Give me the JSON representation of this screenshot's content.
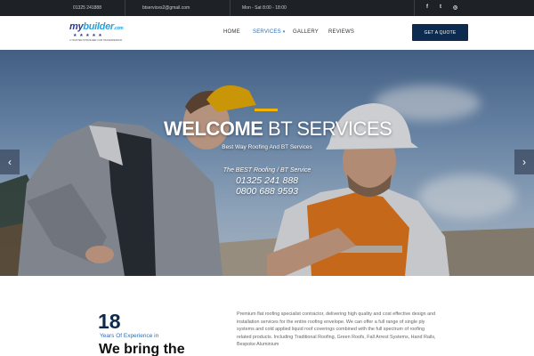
{
  "topbar": {
    "phone": "01325 241888",
    "email": "btservices2@gmail.com",
    "hours": "Mon - Sat 8:00 - 18:00",
    "social": [
      {
        "icon": "facebook-icon",
        "glyph": "f"
      },
      {
        "icon": "twitter-icon",
        "glyph": "t"
      },
      {
        "icon": "instagram-icon",
        "glyph": "◎"
      }
    ]
  },
  "logo": {
    "text_main": "my",
    "text_accent": "builder",
    "text_suffix": ".com",
    "stars": "★ ★ ★ ★ ★",
    "tagline": "A TRUSTED MYBUILDER.COM TRADESPERSON"
  },
  "nav": {
    "items": [
      "HOME",
      "SERVICES",
      "GALLERY",
      "REVIEWS"
    ],
    "active": "SERVICES",
    "cta": "GET A QUOTE"
  },
  "hero": {
    "title_bold": "WELCOME",
    "title_light": "BT SERVICES",
    "subtitle": "Best Way Roofing And BT Services",
    "best_line": "The BEST Roofing / BT Service",
    "phone1": "01325 241 888",
    "phone2": "0800 688 9593",
    "prev_arrow": "‹",
    "next_arrow": "›"
  },
  "about": {
    "years_number": "18",
    "years_label": "Years Of Experience in",
    "heading": "We bring the",
    "paragraph": "Premium flat roofing specialist contractor, delivering high quality and cost effective design and installation services for the entire roofing envelope. We can offer a full range of single ply systems and cold applied liquid roof coverings combined with the full spectrum of roofing related products. Including Traditional Roofing, Green Roofs, Fall Arrest Systems, Hand Rails, Bespoke Aluminium"
  },
  "colors": {
    "topbar": "#1e2126",
    "brand_dark": "#0d2a4f",
    "accent_yellow": "#f2b300",
    "link_blue": "#2f6fb2"
  }
}
